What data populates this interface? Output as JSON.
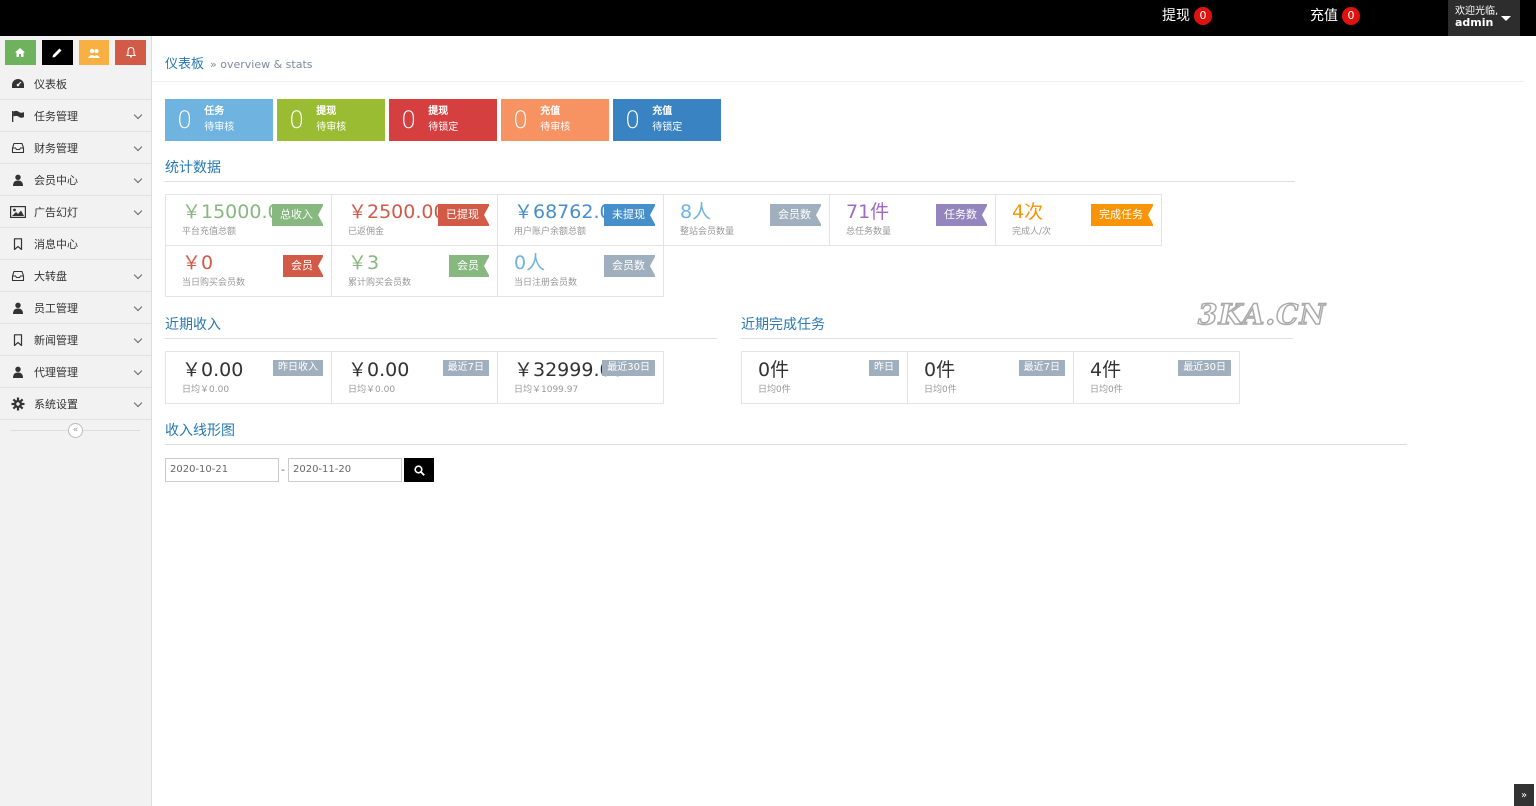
{
  "navbar": {
    "withdraw_label": "提现",
    "withdraw_count": "0",
    "recharge_label": "充值",
    "recharge_count": "0",
    "welcome": "欢迎光临,",
    "username": "admin"
  },
  "sidebar": {
    "shortcuts": [
      {
        "icon": "home-icon",
        "color": "#6fb25e"
      },
      {
        "icon": "pencil-icon",
        "color": "#000000"
      },
      {
        "icon": "users-icon",
        "color": "#f8b042"
      },
      {
        "icon": "bell-icon",
        "color": "#d15b47"
      }
    ],
    "items": [
      {
        "label": "仪表板",
        "icon": "dashboard-icon",
        "has_submenu": false
      },
      {
        "label": "任务管理",
        "icon": "flag-icon",
        "has_submenu": true
      },
      {
        "label": "财务管理",
        "icon": "inbox-icon",
        "has_submenu": true
      },
      {
        "label": "会员中心",
        "icon": "user-icon",
        "has_submenu": true
      },
      {
        "label": "广告幻灯",
        "icon": "picture-icon",
        "has_submenu": true
      },
      {
        "label": "消息中心",
        "icon": "bookmark-icon",
        "has_submenu": false
      },
      {
        "label": "大转盘",
        "icon": "inbox-icon",
        "has_submenu": true
      },
      {
        "label": "员工管理",
        "icon": "user-icon",
        "has_submenu": true
      },
      {
        "label": "新闻管理",
        "icon": "bookmark-icon",
        "has_submenu": true
      },
      {
        "label": "代理管理",
        "icon": "user-icon",
        "has_submenu": true
      },
      {
        "label": "系统设置",
        "icon": "cog-icon",
        "has_submenu": true
      }
    ]
  },
  "breadcrumb": {
    "title": "仪表板",
    "sub": "» overview & stats"
  },
  "tiles": [
    {
      "num": "0",
      "line1": "任务",
      "line2": "待审核",
      "color": "#6fb3e0"
    },
    {
      "num": "0",
      "line1": "提现",
      "line2": "待审核",
      "color": "#9abc32"
    },
    {
      "num": "0",
      "line1": "提现",
      "line2": "待锁定",
      "color": "#d53f40"
    },
    {
      "num": "0",
      "line1": "充值",
      "line2": "待审核",
      "color": "#f79263"
    },
    {
      "num": "0",
      "line1": "充值",
      "line2": "待锁定",
      "color": "#3983c2"
    }
  ],
  "stats": {
    "title": "统计数据",
    "row1": [
      {
        "value": "￥15000.00",
        "desc": "平台充值总额",
        "ribbon": "总收入",
        "value_color": "#87b87f",
        "ribbon_color": "#87b87f"
      },
      {
        "value": "￥2500.00",
        "desc": "已返佣金",
        "ribbon": "已提现",
        "value_color": "#d15b47",
        "ribbon_color": "#d15b47"
      },
      {
        "value": "￥68762.00",
        "desc": "用户账户余额总额",
        "ribbon": "未提现",
        "value_color": "#478fca",
        "ribbon_color": "#478fca"
      },
      {
        "value": "8人",
        "desc": "整站会员数量",
        "ribbon": "会员数",
        "value_color": "#6fb3e0",
        "ribbon_color": "#a0afbd"
      },
      {
        "value": "71件",
        "desc": "总任务数量",
        "ribbon": "任务数",
        "value_color": "#a069c3",
        "ribbon_color": "#9585bf"
      },
      {
        "value": "4次",
        "desc": "完成人/次",
        "ribbon": "完成任务",
        "value_color": "#f89406",
        "ribbon_color": "#f89406"
      }
    ],
    "row2": [
      {
        "value": "￥0",
        "desc": "当日购买会员数",
        "ribbon": "会员",
        "value_color": "#d15b47",
        "ribbon_color": "#d15b47"
      },
      {
        "value": "￥3",
        "desc": "累计购买会员数",
        "ribbon": "会员",
        "value_color": "#87b87f",
        "ribbon_color": "#87b87f"
      },
      {
        "value": "0人",
        "desc": "当日注册会员数",
        "ribbon": "会员数",
        "value_color": "#6fb3e0",
        "ribbon_color": "#a0afbd"
      }
    ]
  },
  "income": {
    "title": "近期收入",
    "boxes": [
      {
        "value": "￥0.00",
        "desc": "日均￥0.00",
        "tag": "昨日收入"
      },
      {
        "value": "￥0.00",
        "desc": "日均￥0.00",
        "tag": "最近7日"
      },
      {
        "value": "￥32999.00",
        "desc": "日均￥1099.97",
        "tag": "最近30日"
      }
    ]
  },
  "tasks": {
    "title": "近期完成任务",
    "boxes": [
      {
        "value": "0件",
        "desc": "日均0件",
        "tag": "昨日"
      },
      {
        "value": "0件",
        "desc": "日均0件",
        "tag": "最近7日"
      },
      {
        "value": "4件",
        "desc": "日均0件",
        "tag": "最近30日"
      }
    ]
  },
  "chart_section": {
    "title": "收入线形图",
    "date_from": "2020-10-21",
    "date_separator": "-",
    "date_to": "2020-11-20"
  },
  "watermark": "3KA.CN"
}
